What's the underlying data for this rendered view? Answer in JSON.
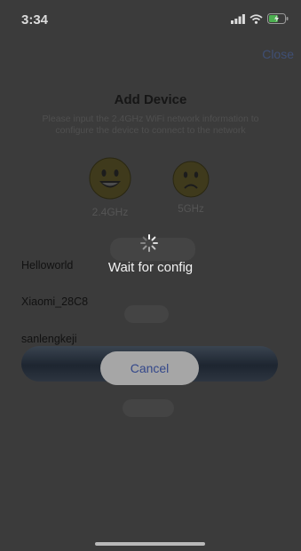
{
  "status_bar": {
    "time": "3:34",
    "icons": [
      "cellular-signal-icon",
      "wifi-icon",
      "battery-charging-icon"
    ]
  },
  "header": {
    "close_label": "Close",
    "title": "Add Device"
  },
  "instruction": "Please input the 2.4GHz WiFi network information to configure the device to connect to the network",
  "bands": [
    {
      "label": "2.4GHz",
      "icon": "happy-face-icon",
      "supported": true
    },
    {
      "label": "5GHz",
      "icon": "sad-face-icon",
      "supported": false
    }
  ],
  "wifi_networks": [
    "Helloworld",
    "Xiaomi_28C8",
    "sanlengkeji"
  ],
  "hud": {
    "message": "Wait for config",
    "cancel_label": "Cancel"
  },
  "colors": {
    "overlay_background": "#3b3b3b",
    "accent_blue": "#33478a",
    "face_yellow": "#3f3a1c"
  }
}
